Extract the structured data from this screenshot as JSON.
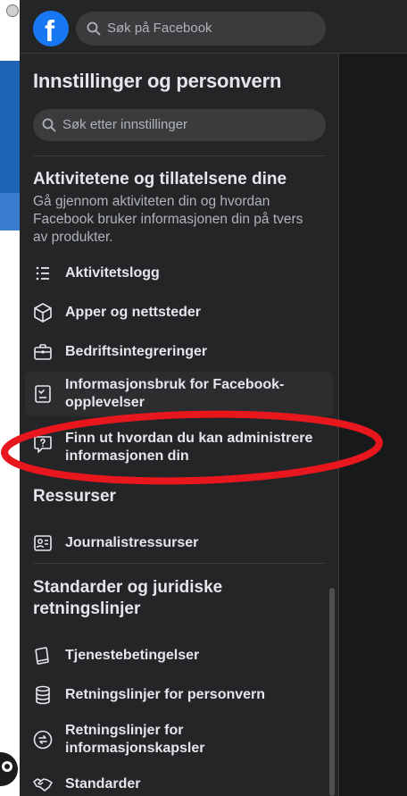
{
  "header": {
    "logo_letter": "f",
    "search_placeholder": "Søk på Facebook"
  },
  "panel": {
    "title": "Innstillinger og personvern",
    "search_placeholder": "Søk etter innstillinger"
  },
  "sections": [
    {
      "title": "Aktivitetene og tillatelsene dine",
      "description": "Gå gjennom aktiviteten din og hvordan Facebook bruker informasjonen din på tvers av produkter.",
      "items": [
        {
          "label": "Aktivitetslogg",
          "icon": "list-icon"
        },
        {
          "label": "Apper og nettsteder",
          "icon": "cube-icon"
        },
        {
          "label": "Bedriftsintegreringer",
          "icon": "briefcase-icon"
        },
        {
          "label": "Informasjonsbruk for Facebook-opplevelser",
          "icon": "checklist-icon"
        },
        {
          "label": "Finn ut hvordan du kan administrere informasjonen din",
          "icon": "question-bubble-icon"
        }
      ]
    },
    {
      "title": "Ressurser",
      "items": [
        {
          "label": "Journalistressurser",
          "icon": "newspaper-icon"
        }
      ]
    },
    {
      "title": "Standarder og juridiske retningslinjer",
      "items": [
        {
          "label": "Tjenestebetingelser",
          "icon": "book-icon"
        },
        {
          "label": "Retningslinjer for personvern",
          "icon": "database-icon"
        },
        {
          "label": "Retningslinjer for informasjonskapsler",
          "icon": "cookie-arrows-icon"
        },
        {
          "label": "Standarder",
          "icon": "handshake-icon"
        }
      ]
    }
  ],
  "colors": {
    "brand": "#1877f2",
    "panel_bg": "#242526",
    "annotation": "#e8161d"
  }
}
